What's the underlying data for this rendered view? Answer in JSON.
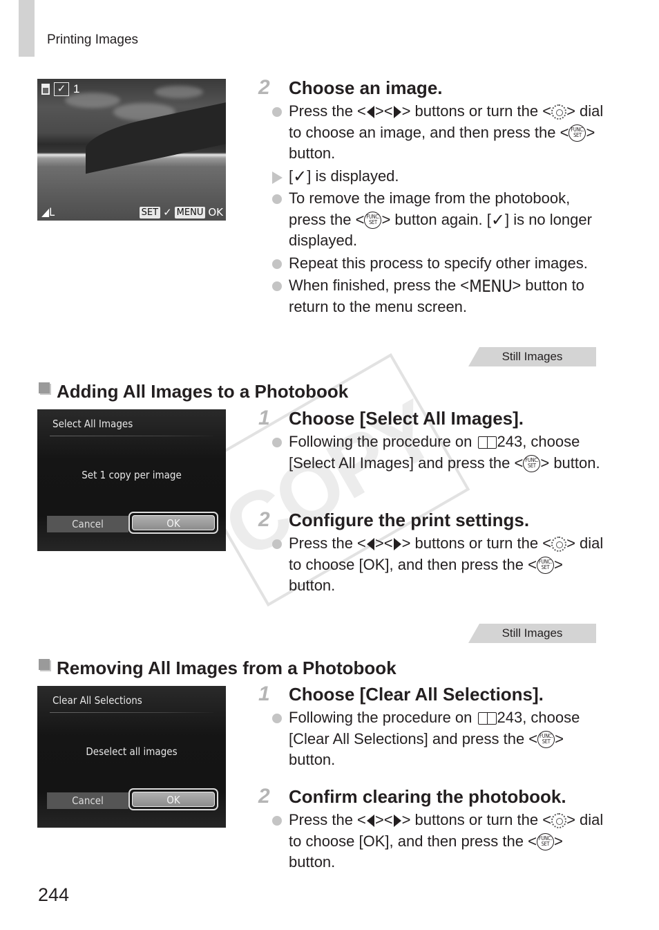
{
  "page": {
    "running_head": "Printing Images",
    "page_number": "244",
    "watermark": "COPY"
  },
  "top": {
    "screen": {
      "frame_count": "1",
      "size_label": "L",
      "osd_set_key": "SET",
      "osd_check": "✓",
      "osd_menu_key": "MENU",
      "osd_ok": "OK"
    },
    "step": {
      "number": "2",
      "title": "Choose an image.",
      "bullets": [
        {
          "type": "dot",
          "parts": [
            "Press the <",
            "left-arrow-icon",
            "><",
            "right-arrow-icon",
            "> buttons or turn the <",
            "control-dial-icon",
            "> dial to choose an image, and then press the <",
            "func-set-icon",
            "> button."
          ]
        },
        {
          "type": "arrow",
          "parts": [
            "[",
            "check-icon",
            "] is displayed."
          ]
        },
        {
          "type": "dot",
          "parts": [
            "To remove the image from the photobook, press the <",
            "func-set-icon",
            "> button again. [",
            "check-icon",
            "] is no longer displayed."
          ]
        },
        {
          "type": "dot",
          "parts": [
            "Repeat this process to specify other images."
          ]
        },
        {
          "type": "dot",
          "parts": [
            "When finished, press the <",
            "menu-icon",
            "> button to return to the menu screen."
          ]
        }
      ]
    }
  },
  "icons": {
    "check": "✓",
    "menu": "MENU",
    "func_top": "FUNC.",
    "func_bottom": "SET"
  },
  "sections": [
    {
      "tab": "Still Images",
      "title": "Adding All Images to a Photobook",
      "screen": {
        "title": "Select All Images",
        "message": "Set 1 copy per image",
        "cancel": "Cancel",
        "ok": "OK"
      },
      "steps": [
        {
          "number": "1",
          "title": "Choose [Select All Images].",
          "bullets": [
            {
              "type": "dot",
              "parts": [
                "Following the procedure on ",
                "book-icon",
                "243, choose [Select All Images] and press the <",
                "func-set-icon",
                "> button."
              ]
            }
          ]
        },
        {
          "number": "2",
          "title": "Configure the print settings.",
          "bullets": [
            {
              "type": "dot",
              "parts": [
                "Press the <",
                "left-arrow-icon",
                "><",
                "right-arrow-icon",
                "> buttons or turn the <",
                "control-dial-icon",
                "> dial to choose [OK], and then press the <",
                "func-set-icon",
                "> button."
              ]
            }
          ]
        }
      ]
    },
    {
      "tab": "Still Images",
      "title": "Removing All Images from a Photobook",
      "screen": {
        "title": "Clear All Selections",
        "message": "Deselect all images",
        "cancel": "Cancel",
        "ok": "OK"
      },
      "steps": [
        {
          "number": "1",
          "title": "Choose [Clear All Selections].",
          "bullets": [
            {
              "type": "dot",
              "parts": [
                "Following the procedure on ",
                "book-icon",
                "243, choose [Clear All Selections] and press the <",
                "func-set-icon",
                "> button."
              ]
            }
          ]
        },
        {
          "number": "2",
          "title": "Confirm clearing the photobook.",
          "bullets": [
            {
              "type": "dot",
              "parts": [
                "Press the <",
                "left-arrow-icon",
                "><",
                "right-arrow-icon",
                "> buttons or turn the <",
                "control-dial-icon",
                "> dial to choose [OK], and then press the <",
                "func-set-icon",
                "> button."
              ]
            }
          ]
        }
      ]
    }
  ]
}
